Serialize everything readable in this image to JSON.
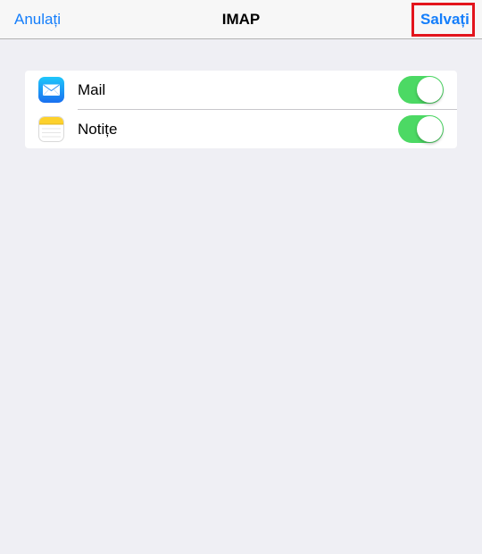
{
  "navbar": {
    "cancel_label": "Anulați",
    "title": "IMAP",
    "save_label": "Salvați"
  },
  "settings": {
    "items": [
      {
        "label": "Mail",
        "icon": "mail-app-icon",
        "enabled": true
      },
      {
        "label": "Notițe",
        "icon": "notes-app-icon",
        "enabled": true
      }
    ]
  },
  "colors": {
    "accent": "#147efb",
    "toggle_on": "#4cd964",
    "highlight": "#e3141c",
    "background": "#efeff4"
  }
}
